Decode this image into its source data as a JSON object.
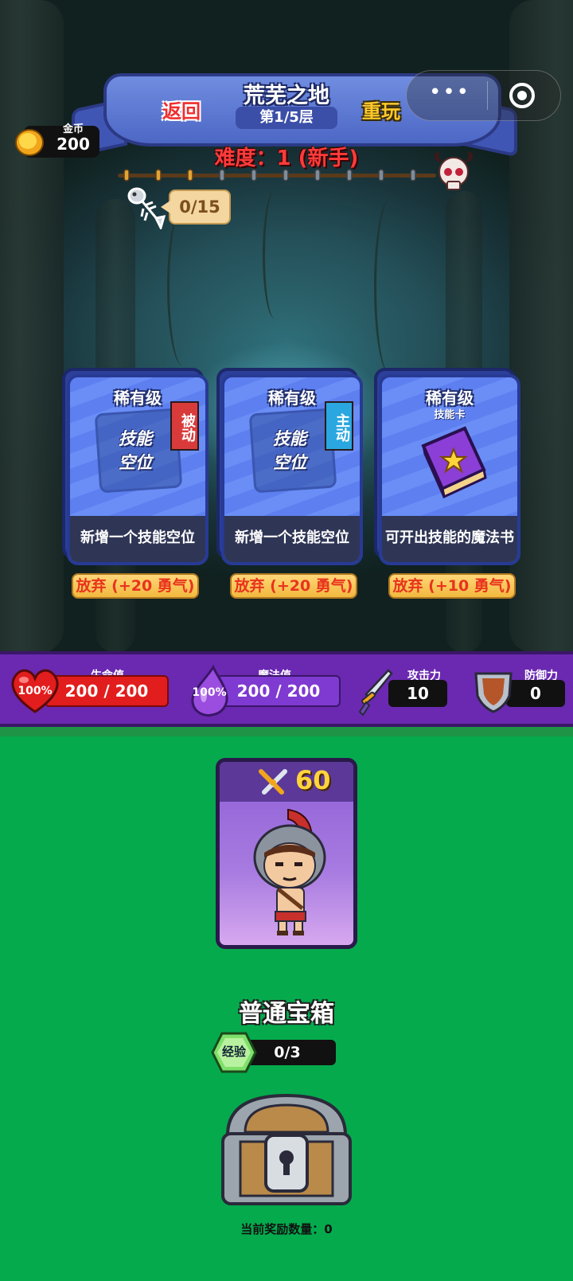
{
  "header": {
    "title": "荒芜之地",
    "floor": "第1/5层",
    "back_label": "返回",
    "replay_label": "重玩",
    "more_icon": "•••"
  },
  "coins": {
    "label": "金币",
    "value": "200"
  },
  "difficulty": "难度：1 (新手)",
  "fish_progress": "0/15",
  "cards": [
    {
      "rarity": "稀有级",
      "slot_text_line1": "技能",
      "slot_text_line2": "空位",
      "tag": "被动",
      "description": "新增一个技能空位",
      "discard": "放弃 (+20 勇气)"
    },
    {
      "rarity": "稀有级",
      "slot_text_line1": "技能",
      "slot_text_line2": "空位",
      "tag": "主动",
      "description": "新增一个技能空位",
      "discard": "放弃 (+20 勇气)"
    },
    {
      "rarity": "稀有级",
      "subtitle": "技能卡",
      "description": "可开出技能的魔法书",
      "discard": "放弃 (+10 勇气)"
    }
  ],
  "stats": {
    "hp": {
      "label": "生命值",
      "value": "200 / 200",
      "percent": "100%"
    },
    "mp": {
      "label": "魔法值",
      "value": "200 / 200",
      "percent": "100%"
    },
    "attack": {
      "label": "攻击力",
      "value": "10"
    },
    "defense": {
      "label": "防御力",
      "value": "0"
    }
  },
  "hero": {
    "power": "60"
  },
  "chest": {
    "title": "普通宝箱",
    "exp_label": "经验",
    "exp_value": "0/3",
    "reward_count": "当前奖励数量：0"
  },
  "colors": {
    "background_green": "#05aa4d",
    "stat_purple": "#6a29b0",
    "card_blue": "#5d7ff0",
    "hp_red": "#e21d1d",
    "gold": "#ffd43b"
  }
}
